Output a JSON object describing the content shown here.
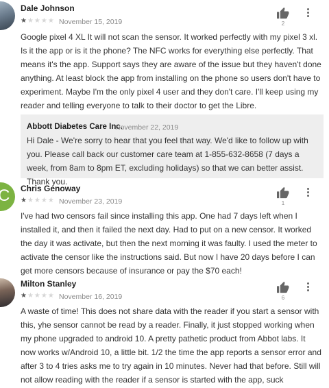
{
  "reviews": [
    {
      "author": "Dale Johnson",
      "rating": 1,
      "date": "November 15, 2019",
      "helpful_count": "2",
      "text": "Google pixel 4 XL It will not scan the sensor. It worked perfectly with my pixel 3 xl. Is it the app or is it the phone? The NFC works for everything else perfectly. That means it's the app. Support says they are aware of the issue but they haven't done anything. At least block the app from installing on the phone so users don't have to experiment. Maybe I'm the only pixel 4 user and they don't care. I'll keep using my reader and telling everyone to talk to their doctor to get the Libre.",
      "reply": {
        "developer": "Abbott Diabetes Care Inc.",
        "date": "November 22, 2019",
        "text": "Hi Dale - We're sorry to hear that you feel that way. We'd like to follow up with you. Please call back our customer care team at 1-855-632-8658 (7 days a week, from 8am to 8pm ET, excluding holidays) so that we can better assist. Thank you."
      }
    },
    {
      "author": "Chris Genoway",
      "avatar_letter": "C",
      "rating": 1,
      "date": "November 23, 2019",
      "helpful_count": "1",
      "text": "I've had two censors fail since installing this app. One had 7 days left when I installed it, and then it failed the next day. Had to put on a new censor. It worked the day it was activate, but then the next morning it was faulty. I used the meter to activate the censor like the instructions said. But now I have 20 days before I can get more censors because of insurance or pay the $70 each!"
    },
    {
      "author": "Milton Stanley",
      "rating": 1,
      "date": "November 16, 2019",
      "helpful_count": "6",
      "text": "A waste of time! This does not share data with the reader if you start a sensor with this, yhe sensor cannot be read by a reader. Finally, it just stopped working when my phone upgraded to android 10. A pretty pathetic product from Abbot labs. It now works w/Android 10, a little bit. 1/2 the time the app reports a sensor error and after 3 to 4 tries asks me to try again in 10 minutes. Never had that before. Still will not allow reading with the reader if a sensor is started with the app, suck"
    }
  ],
  "colors": {
    "star_on": "#555555",
    "star_off": "#d6d6d6",
    "reply_bg": "#eeeeee",
    "avatar_c": "#7cb342"
  },
  "icons": {
    "helpful": "thumbs-up-icon",
    "menu": "more-vert-icon"
  }
}
